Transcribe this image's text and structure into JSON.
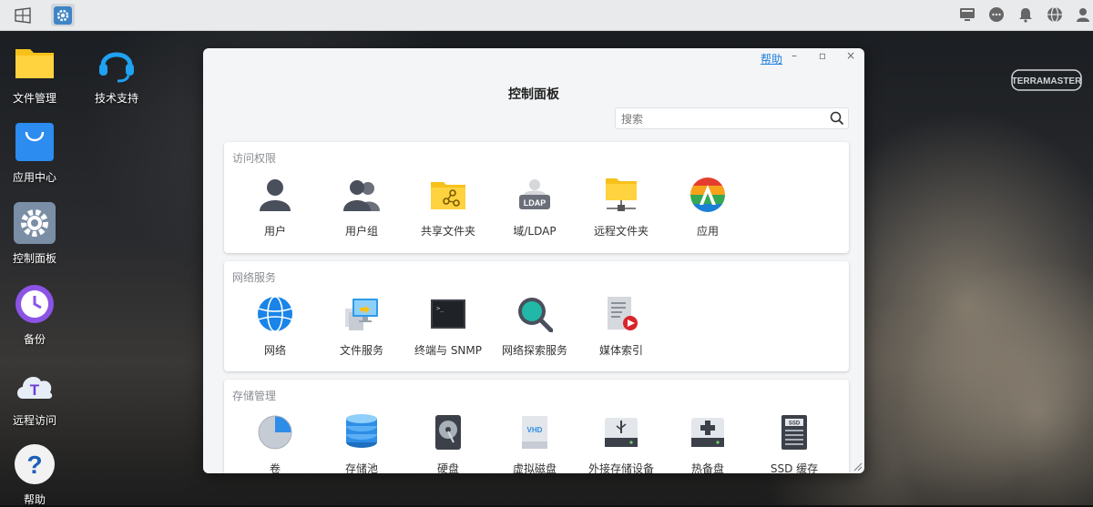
{
  "taskbar": {
    "left_icons": [
      "windows-icon",
      "control-panel-icon"
    ],
    "right_icons": [
      "monitor-icon",
      "chat-icon",
      "bell-icon",
      "globe-icon",
      "user-icon"
    ]
  },
  "desktop": {
    "icons": [
      {
        "label": "文件管理",
        "icon": "folder-icon"
      },
      {
        "label": "技术支持",
        "icon": "headset-icon"
      },
      {
        "label": "应用中心",
        "icon": "shopping-bag-icon"
      },
      {
        "label": "控制面板",
        "icon": "gear-icon"
      },
      {
        "label": "备份",
        "icon": "clock-icon"
      },
      {
        "label": "远程访问",
        "icon": "cloud-icon"
      },
      {
        "label": "帮助",
        "icon": "question-icon"
      }
    ],
    "brand_logo": "TERRAMASTER"
  },
  "window": {
    "help_link": "帮助",
    "minimize": "–",
    "maximize": "▫",
    "close": "×",
    "title": "控制面板",
    "search_placeholder": "搜索",
    "sections": [
      {
        "title": "访问权限",
        "items": [
          {
            "label": "用户",
            "icon": "user-icon"
          },
          {
            "label": "用户组",
            "icon": "user-group-icon"
          },
          {
            "label": "共享文件夹",
            "icon": "shared-folder-icon"
          },
          {
            "label": "域/LDAP",
            "icon": "ldap-icon",
            "badge": "LDAP"
          },
          {
            "label": "远程文件夹",
            "icon": "remote-folder-icon"
          },
          {
            "label": "应用",
            "icon": "apps-icon"
          }
        ]
      },
      {
        "title": "网络服务",
        "items": [
          {
            "label": "网络",
            "icon": "globe-icon"
          },
          {
            "label": "文件服务",
            "icon": "file-service-icon"
          },
          {
            "label": "终端与 SNMP",
            "icon": "terminal-icon",
            "badge": ">_"
          },
          {
            "label": "网络探索服务",
            "icon": "magnifier-icon"
          },
          {
            "label": "媒体索引",
            "icon": "media-index-icon"
          }
        ]
      },
      {
        "title": "存储管理",
        "items": [
          {
            "label": "卷",
            "icon": "pie-volume-icon"
          },
          {
            "label": "存储池",
            "icon": "storage-pool-icon"
          },
          {
            "label": "硬盘",
            "icon": "hard-disk-icon"
          },
          {
            "label": "虚拟磁盘",
            "icon": "vhd-icon",
            "badge": "VHD"
          },
          {
            "label": "外接存储设备",
            "icon": "usb-storage-icon"
          },
          {
            "label": "热备盘",
            "icon": "hot-spare-icon"
          },
          {
            "label": "SSD 缓存",
            "icon": "ssd-cache-icon",
            "badge": "SSD"
          }
        ]
      }
    ]
  },
  "colors": {
    "accent": "#1e7ee0",
    "folder": "#f7c11b",
    "taskbar": "#e9eaec"
  }
}
